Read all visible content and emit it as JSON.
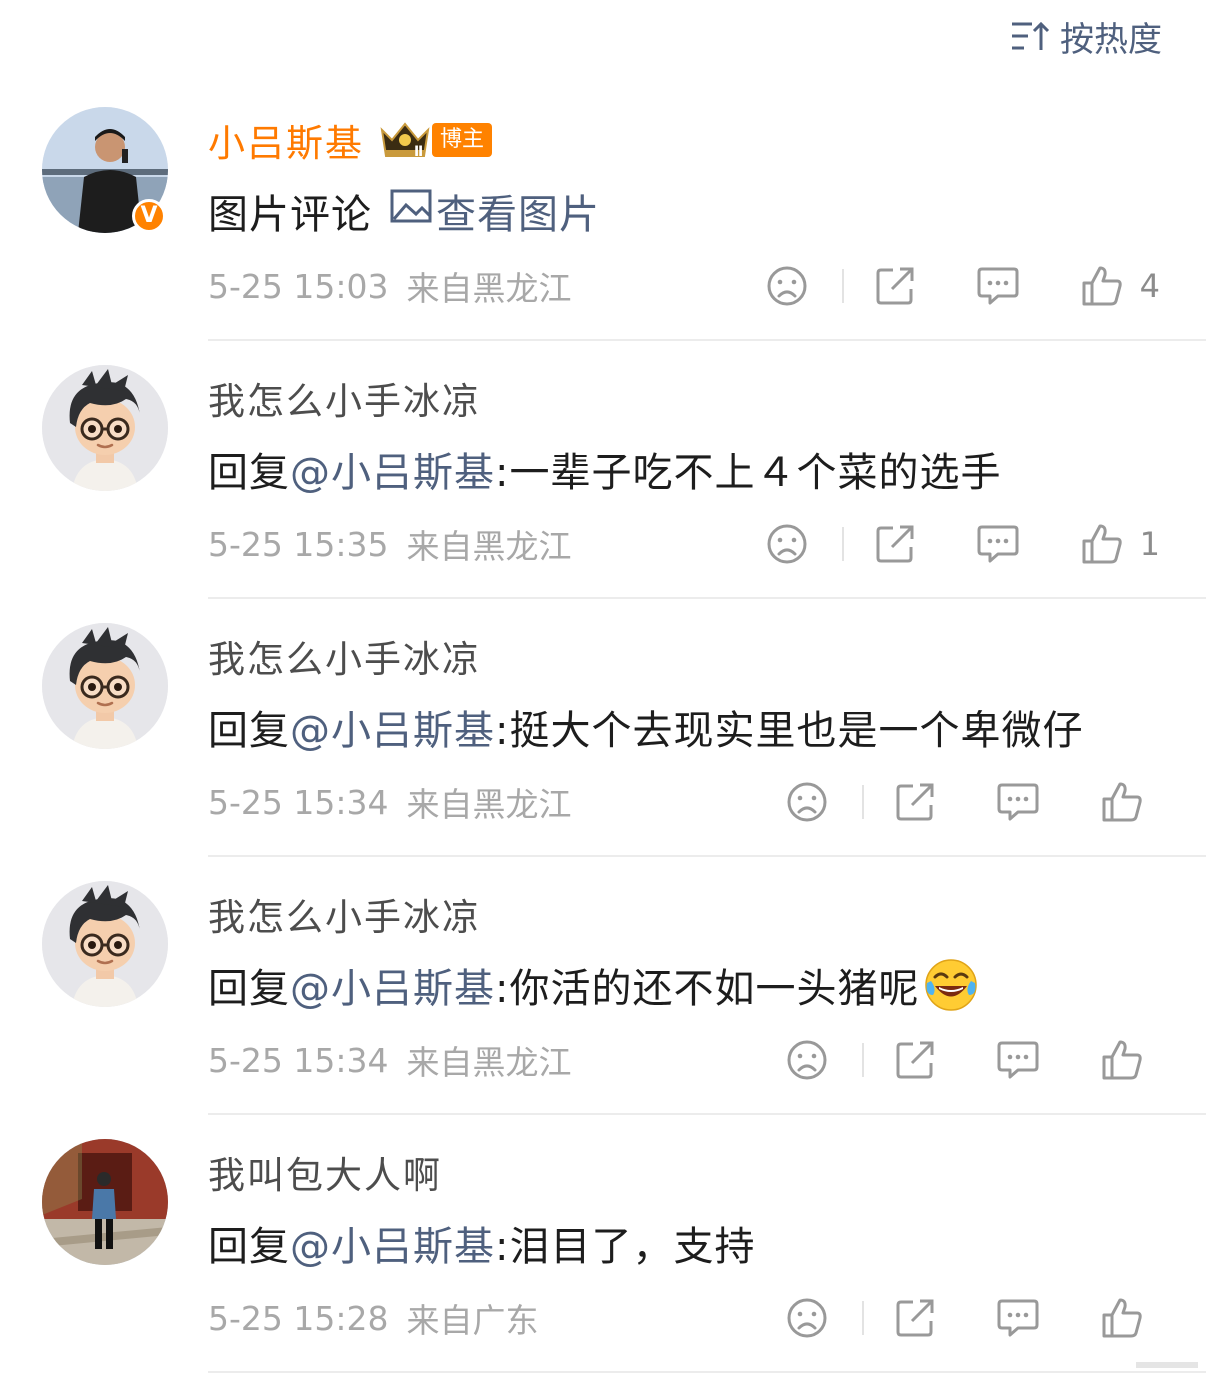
{
  "sort": {
    "label": "按热度",
    "icon": "sort-icon"
  },
  "colors": {
    "link": "#4f607e",
    "author": "#ff7a00",
    "meta": "#a8a8a8",
    "badge": "#ff8200"
  },
  "comments": [
    {
      "username": "小吕斯基",
      "is_author": true,
      "badge": "博主",
      "crown_level": "Ⅱ",
      "verified": "V",
      "text": "图片评论",
      "view_pic": "查看图片",
      "time": "5-25 15:03",
      "location": "来自黑龙江",
      "likes": "4"
    },
    {
      "username": "我怎么小手冰凉",
      "reply_prefix": "回复",
      "mention": "@小吕斯基",
      "text": ":一辈子吃不上４个菜的选手",
      "time": "5-25 15:35",
      "location": "来自黑龙江",
      "likes": "1"
    },
    {
      "username": "我怎么小手冰凉",
      "reply_prefix": "回复",
      "mention": "@小吕斯基",
      "text": ":挺大个去现实里也是一个卑微仔",
      "time": "5-25 15:34",
      "location": "来自黑龙江",
      "likes": ""
    },
    {
      "username": "我怎么小手冰凉",
      "reply_prefix": "回复",
      "mention": "@小吕斯基",
      "text": ":你活的还不如一头猪呢",
      "emoji": "laugh-cry-emoji",
      "time": "5-25 15:34",
      "location": "来自黑龙江",
      "likes": ""
    },
    {
      "username": "我叫包大人啊",
      "reply_prefix": "回复",
      "mention": "@小吕斯基",
      "text": ":泪目了，支持",
      "time": "5-25 15:28",
      "location": "来自广东",
      "likes": ""
    }
  ]
}
